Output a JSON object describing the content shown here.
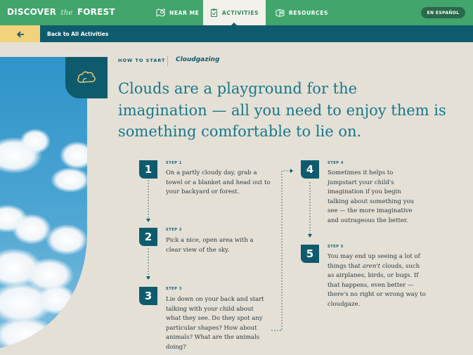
{
  "nav": {
    "logo_left": "DISCOVER",
    "logo_mid": "the",
    "logo_right": "FOREST",
    "items": [
      {
        "label": "NEAR ME",
        "icon": "map-pin-icon"
      },
      {
        "label": "ACTIVITIES",
        "icon": "clipboard-icon",
        "active": true
      },
      {
        "label": "RESOURCES",
        "icon": "resources-icon"
      }
    ],
    "lang_button": "EN ESPAÑOL"
  },
  "subbar": {
    "back_label": "Back to All Activities"
  },
  "header": {
    "howto": "HOW TO START",
    "activity": "Cloudgazing",
    "headline": "Clouds are a playground for the imagination — all you need to enjoy them is something comfortable to lie on."
  },
  "steps": [
    {
      "num": "1",
      "label": "STEP 1",
      "text": "On a partly cloudy day, grab a towel or a blanket and head out to your backyard or forest."
    },
    {
      "num": "2",
      "label": "STEP 2",
      "text": "Pick a nice, open area with a clear view of the sky."
    },
    {
      "num": "3",
      "label": "STEP 3",
      "text": "Lie down on your back and start talking with your child about what they see. Do they spot any particular shapes? How about animals? What are the animals doing?"
    },
    {
      "num": "4",
      "label": "STEP 4",
      "text": "Sometimes it helps to jumpstart your child's imagination if you begin talking about something you see — the more imaginative and outrageous the better."
    },
    {
      "num": "5",
      "label": "STEP 5",
      "text_before": "You may end up seeing a lot of things that ",
      "text_em": "aren't",
      "text_after": " clouds, such as airplanes, birds, or bugs. If that happens, even better — there's no right or wrong way to cloudgaze."
    }
  ],
  "colors": {
    "nav_green": "#41a56c",
    "teal": "#0f5b6e",
    "back_yellow": "#f2d27a",
    "background": "#e5e0d6"
  }
}
